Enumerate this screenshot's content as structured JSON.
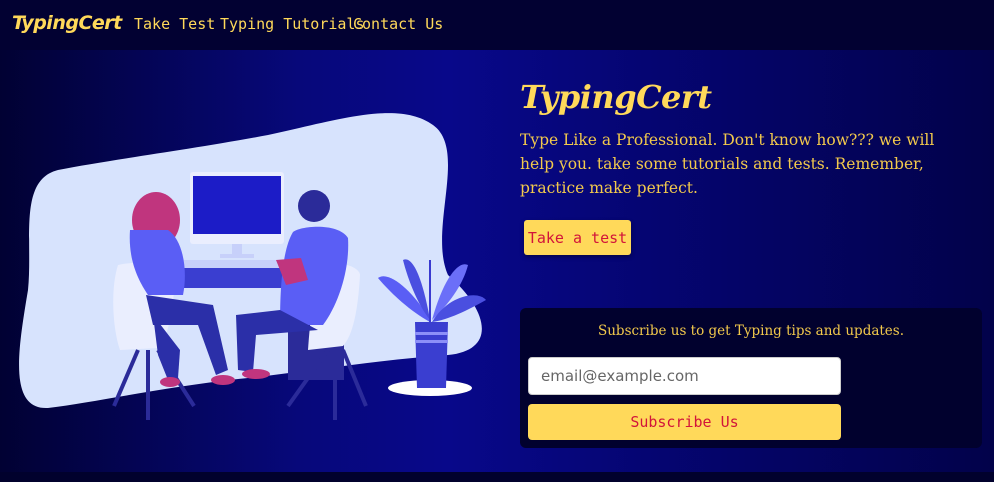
{
  "nav": {
    "brand": "TypingCert",
    "links": [
      "Take Test",
      "Typing Tutorials",
      "Contact Us"
    ]
  },
  "hero": {
    "title": "TypingCert",
    "description": "Type Like a Professional. Don't know how??? we will help you. take some tutorials and tests. Remember, practice make perfect.",
    "cta_label": "Take a test"
  },
  "subscribe": {
    "text": "Subscribe us to get Typing tips and updates.",
    "email_placeholder": "email@example.com",
    "button_label": "Subscribe Us"
  },
  "colors": {
    "accent": "#ffd95a",
    "button_text": "#d2143a",
    "navbar_bg": "#020132",
    "hero_bg": "#07087a"
  },
  "icons": [
    "illustration-people-at-computer"
  ]
}
